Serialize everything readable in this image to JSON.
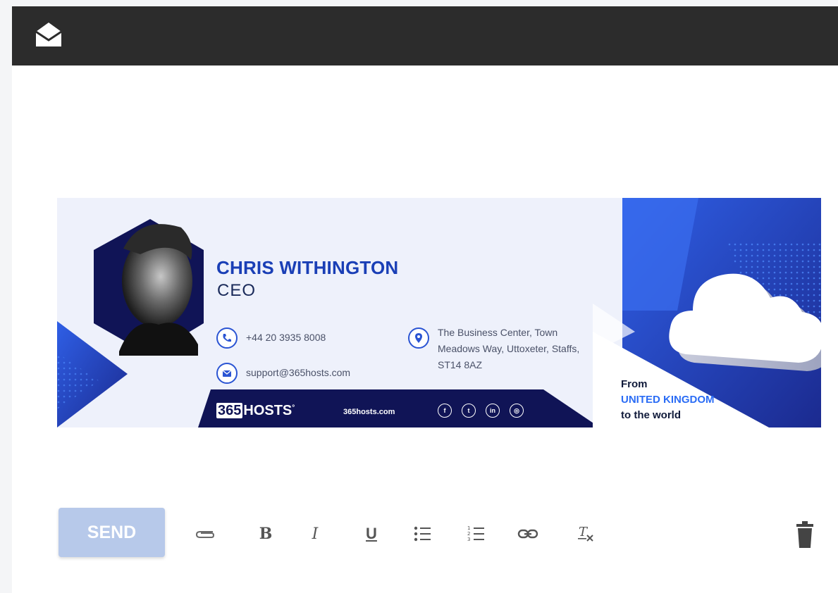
{
  "app": {
    "icon": "envelope-open-icon"
  },
  "signature": {
    "name": "CHRIS WITHINGTON",
    "role": "CEO",
    "phone": "+44 20 3935 8008",
    "email": "support@365hosts.com",
    "address_lines": [
      "The Business Center, Town",
      "Meadows Way, Uttoxeter, Staffs,",
      "ST14 8AZ"
    ],
    "logo_box": "365",
    "logo_text": "HOSTS",
    "logo_mark": "°",
    "website": "365hosts.com",
    "social": [
      {
        "icon": "facebook-icon",
        "glyph": "f"
      },
      {
        "icon": "twitter-icon",
        "glyph": "t"
      },
      {
        "icon": "linkedin-icon",
        "glyph": "in"
      },
      {
        "icon": "instagram-icon",
        "glyph": "◎"
      }
    ],
    "tagline_1": "From",
    "tagline_2": "UNITED KINGDOM",
    "tagline_3": "to the world",
    "colors": {
      "brand_blue": "#1a3fb6",
      "navy": "#101456",
      "accent": "#2a6cf5"
    }
  },
  "toolbar": {
    "send_label": "SEND",
    "bold_label": "B",
    "italic_label": "I",
    "underline_label": "U",
    "icons": [
      "attach-icon",
      "bold-icon",
      "italic-icon",
      "underline-icon",
      "bulleted-list-icon",
      "numbered-list-icon",
      "link-icon",
      "clear-format-icon",
      "trash-icon"
    ]
  }
}
